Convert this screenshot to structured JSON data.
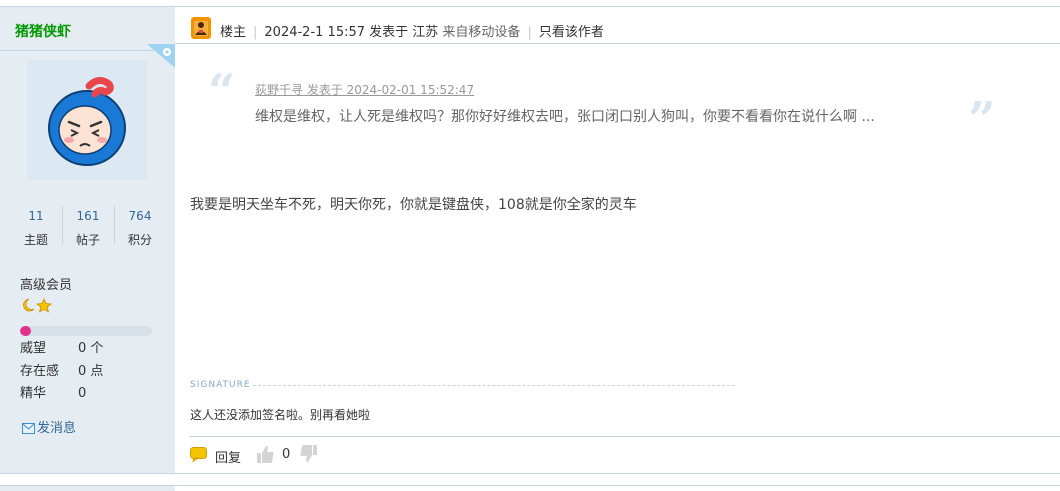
{
  "user": {
    "name": "猪猪侠虾",
    "stats": [
      {
        "value": "11",
        "label": "主题"
      },
      {
        "value": "161",
        "label": "帖子"
      },
      {
        "value": "764",
        "label": "积分"
      }
    ],
    "rank": "高级会员",
    "level_progress": 0.08,
    "info": [
      {
        "key": "威望",
        "value": "0 个"
      },
      {
        "key": "存在感",
        "value": "0 点"
      },
      {
        "key": "精华",
        "value": "0"
      }
    ],
    "send_message": "发消息"
  },
  "post": {
    "floor_label": "楼主",
    "date_text": "2024-2-1 15:57 发表于 江苏",
    "device_text": "来自移动设备",
    "only_author": "只看该作者",
    "quote_meta": "荻野千寻 发表于 2024-02-01 15:52:47",
    "quote_text": "维权是维权，让人死是维权吗？那你好好维权去吧，张口闭口别人狗叫，你要不看看你在说什么啊 ...",
    "body": "我要是明天坐车不死，明天你死，你就是键盘侠，108就是你全家的灵车",
    "signature_label": "SIGNATURE",
    "signature": "这人还没添加签名啦。别再看她啦",
    "reply_label": "回复",
    "like_count": "0"
  },
  "colors": {
    "username": "#009900",
    "link": "#336699",
    "sidebar_bg": "#e5edf2",
    "border": "#c2d5e3",
    "progress": "#e0338e"
  },
  "icons": [
    "avatar",
    "host-badge-icon",
    "moon-star-icon",
    "mail-icon",
    "reply-icon",
    "thumb-up-icon",
    "thumb-down-icon"
  ]
}
